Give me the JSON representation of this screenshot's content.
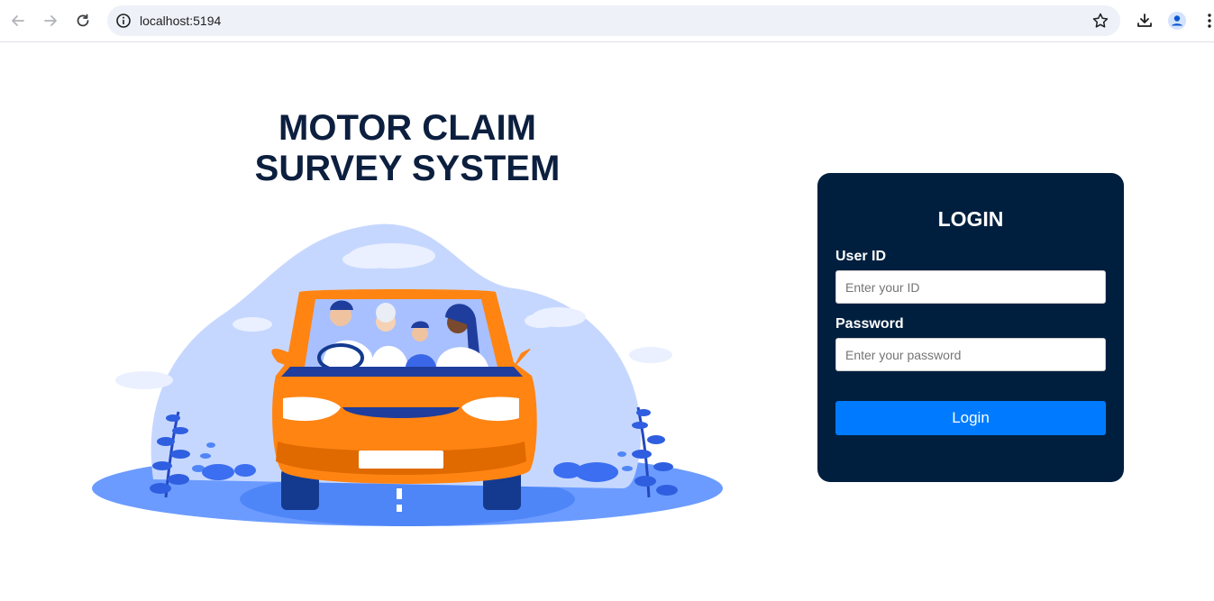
{
  "browser": {
    "url": "localhost:5194",
    "icons": [
      "back-arrow-icon",
      "forward-arrow-icon",
      "reload-icon",
      "site-info-icon",
      "bookmark-star-icon",
      "download-icon",
      "profile-icon",
      "more-options-icon"
    ]
  },
  "hero": {
    "title_line1": "MOTOR CLAIM",
    "title_line2": "SURVEY SYSTEM"
  },
  "login": {
    "title": "LOGIN",
    "userid_label": "User ID",
    "userid_placeholder": "Enter your ID",
    "userid_value": "",
    "password_label": "Password",
    "password_placeholder": "Enter your password",
    "password_value": "",
    "button_label": "Login"
  },
  "colors": {
    "card_bg": "#001f3f",
    "button_bg": "#007bff",
    "title_text": "#0c1f3f",
    "car_orange": "#ff8412",
    "scene_blue": "#c6d7ff"
  }
}
